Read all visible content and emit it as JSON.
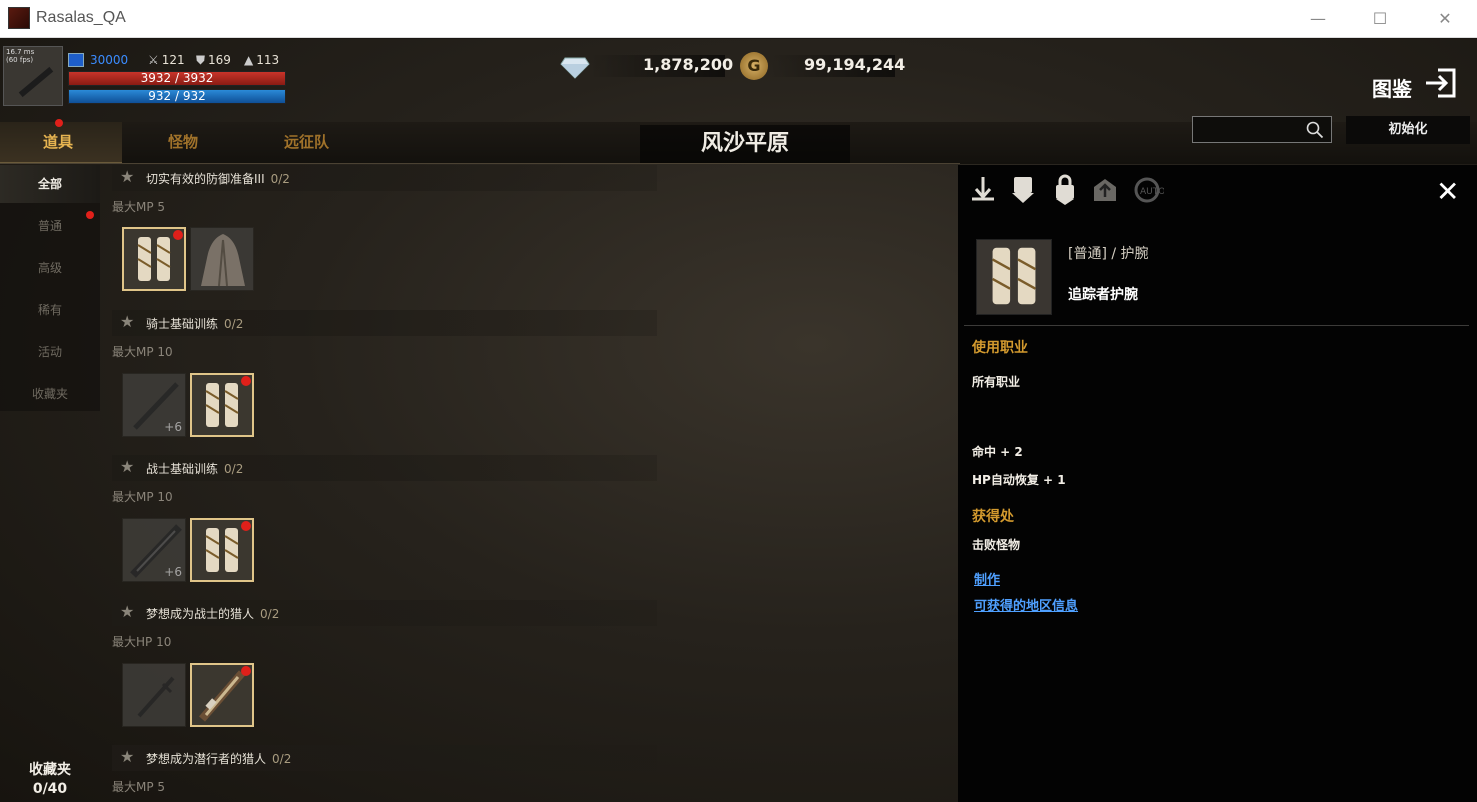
{
  "window": {
    "title": "Rasalas_QA",
    "min": "—",
    "max": "☐",
    "close": "✕"
  },
  "hud": {
    "fps": "16.7 ms\n(60 fps)",
    "mp_total": "30000",
    "stats": {
      "attack": "121",
      "defense": "169",
      "speed": "113"
    },
    "hp": "3932 / 3932",
    "mp": "932 / 932"
  },
  "currency": {
    "gems": "1,878,200",
    "gold_symbol": "G",
    "gold": "99,194,244"
  },
  "header": {
    "codex": "图鉴"
  },
  "tabs": [
    {
      "label": "道具",
      "active": true
    },
    {
      "label": "怪物",
      "active": false
    },
    {
      "label": "远征队",
      "active": false
    }
  ],
  "region": "风沙平原",
  "search": {
    "placeholder": ""
  },
  "init_button": "初始化",
  "categories": [
    {
      "label": "全部",
      "active": true
    },
    {
      "label": "普通",
      "active": false
    },
    {
      "label": "高级",
      "active": false
    },
    {
      "label": "稀有",
      "active": false
    },
    {
      "label": "活动",
      "active": false
    },
    {
      "label": "收藏夹",
      "active": false
    }
  ],
  "favorites": {
    "label": "收藏夹",
    "count": "0/40"
  },
  "collections": [
    {
      "name": "切实有效的防御准备III",
      "progress": "0/2",
      "effect": "最大MP 5"
    },
    {
      "name": "骑士基础训练",
      "progress": "0/2",
      "effect": "最大MP 10"
    },
    {
      "name": "战士基础训练",
      "progress": "0/2",
      "effect": "最大MP 10"
    },
    {
      "name": "梦想成为战士的猎人",
      "progress": "0/2",
      "effect": "最大HP 10"
    },
    {
      "name": "梦想成为潜行者的猎人",
      "progress": "0/2",
      "effect": "最大MP 5"
    }
  ],
  "slot_plus": "+6",
  "detail": {
    "rarity": "[普通] / 护腕",
    "name": "追踪者护腕",
    "class_title": "使用职业",
    "class_value": "所有职业",
    "stat1": "命中 + 2",
    "stat2": "HP自动恢复 + 1",
    "source_title": "获得处",
    "source_value": "击败怪物",
    "link_craft": "制作",
    "link_region": "可获得的地区信息"
  },
  "colors": {
    "accent": "#d39a2e",
    "link": "#4fa0ff",
    "hp": "#c8342a",
    "mp": "#2a8ad8",
    "badge": "#e0201a"
  }
}
